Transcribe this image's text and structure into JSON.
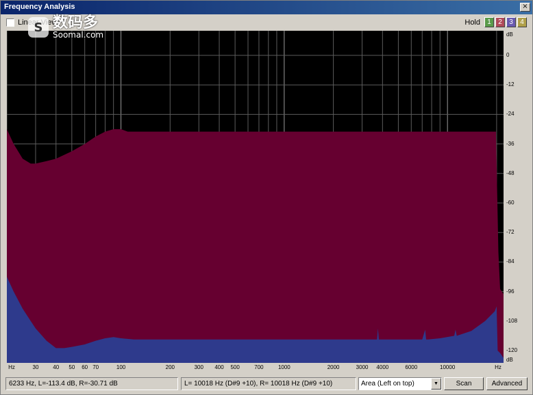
{
  "window": {
    "title": "Frequency Analysis",
    "close_label": "×"
  },
  "toolbar": {
    "linear_view_label": "Linear View",
    "linear_view_checked": false,
    "hold_label": "Hold",
    "hold_buttons": [
      {
        "label": "1",
        "color": "#5a9a4a"
      },
      {
        "label": "2",
        "color": "#b04a5a"
      },
      {
        "label": "3",
        "color": "#6a5ab0"
      },
      {
        "label": "4",
        "color": "#b0a04a"
      }
    ]
  },
  "watermark": {
    "logo_glyph": "S",
    "cn_text": "数码多",
    "en_text": "Soomal.com"
  },
  "chart_data": {
    "type": "area",
    "xscale": "log",
    "xlim": [
      20,
      22050
    ],
    "ylim": [
      -125,
      10
    ],
    "y_unit": "dB",
    "x_unit": "Hz",
    "x_ticks": [
      {
        "value": 30,
        "label": "30"
      },
      {
        "value": 40,
        "label": "40"
      },
      {
        "value": 50,
        "label": "50"
      },
      {
        "value": 60,
        "label": "60"
      },
      {
        "value": 70,
        "label": "70"
      },
      {
        "value": 100,
        "label": "100"
      },
      {
        "value": 200,
        "label": "200"
      },
      {
        "value": 300,
        "label": "300"
      },
      {
        "value": 400,
        "label": "400"
      },
      {
        "value": 500,
        "label": "500"
      },
      {
        "value": 700,
        "label": "700"
      },
      {
        "value": 1000,
        "label": "1000"
      },
      {
        "value": 2000,
        "label": "2000"
      },
      {
        "value": 3000,
        "label": "3000"
      },
      {
        "value": 4000,
        "label": "4000"
      },
      {
        "value": 6000,
        "label": "6000"
      },
      {
        "value": 10000,
        "label": "10000"
      }
    ],
    "y_ticks": [
      0,
      -12,
      -24,
      -36,
      -48,
      -60,
      -72,
      -84,
      -96,
      -108,
      -120
    ],
    "series": [
      {
        "color": "#660030",
        "x": [
          20,
          22,
          25,
          28,
          30,
          35,
          40,
          50,
          60,
          70,
          80,
          90,
          100,
          110,
          120,
          150,
          200,
          500,
          1000,
          5000,
          10000,
          19000,
          19800,
          20500,
          21000,
          22050
        ],
        "y": [
          -30,
          -36,
          -42,
          -44,
          -44,
          -43,
          -42,
          -39,
          -36,
          -33,
          -31,
          -30,
          -30,
          -31,
          -31,
          -31,
          -31,
          -31,
          -31,
          -31,
          -31,
          -31,
          -31,
          -80,
          -95,
          -97
        ]
      },
      {
        "color": "#2e3a8c",
        "x": [
          20,
          22,
          25,
          28,
          30,
          35,
          40,
          45,
          50,
          60,
          70,
          80,
          90,
          100,
          120,
          150,
          200,
          500,
          1000,
          2000,
          3000,
          3700,
          3750,
          3800,
          4000,
          7000,
          7300,
          7400,
          7600,
          9000,
          11000,
          11200,
          11400,
          14000,
          17000,
          19500,
          20000,
          20300,
          21000,
          22050
        ],
        "y": [
          -90,
          -96,
          -103,
          -108,
          -111,
          -116,
          -119,
          -119,
          -118.5,
          -117.5,
          -116,
          -115,
          -114.5,
          -115,
          -115.5,
          -115.5,
          -115.5,
          -115.5,
          -115.5,
          -115.5,
          -115.5,
          -115.5,
          -111,
          -115.5,
          -115.5,
          -115.5,
          -111.5,
          -115.5,
          -115.5,
          -115,
          -114,
          -111.5,
          -114,
          -112,
          -108,
          -104,
          -102,
          -120,
          -121,
          -123
        ]
      }
    ]
  },
  "axes": {
    "y_unit_label": "dB",
    "x_unit_label": "Hz"
  },
  "status": {
    "cursor_readout": "6233 Hz, L=-113.4 dB, R=-30.71 dB",
    "peak_readout": "L= 10018 Hz (D#9 +10), R= 10018 Hz (D#9 +10)",
    "view_mode": "Area (Left on top)",
    "scan_label": "Scan",
    "advanced_label": "Advanced"
  }
}
